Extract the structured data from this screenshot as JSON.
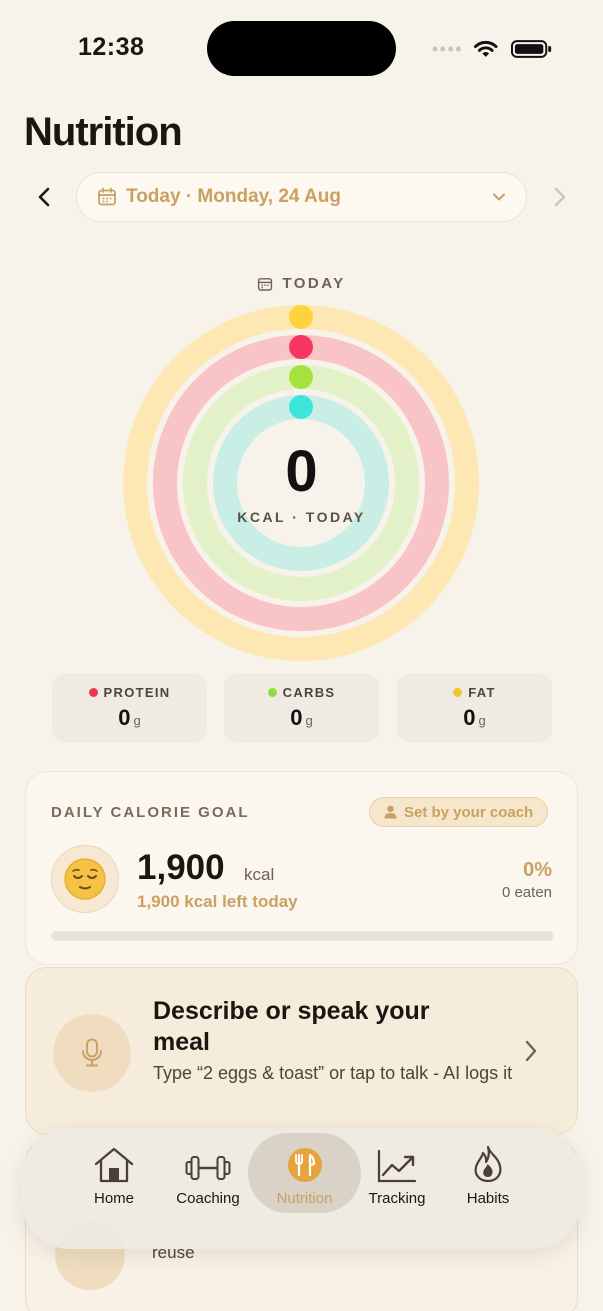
{
  "status_bar": {
    "time": "12:38"
  },
  "header": {
    "title": "Nutrition"
  },
  "date_nav": {
    "label": "Today · Monday, 24 Aug"
  },
  "rings": {
    "heading": "TODAY",
    "calories_value": "0",
    "calories_label": "KCAL · TODAY",
    "ring_colors": [
      "#fde8b4",
      "#f8c4c6",
      "#e2f1c7",
      "#c8eee6"
    ],
    "dot_colors": [
      "#fed33b",
      "#f73663",
      "#a6e23f",
      "#3ee5dc"
    ],
    "progress": [
      0,
      0,
      0,
      0
    ]
  },
  "macros": [
    {
      "name": "PROTEIN",
      "value": "0",
      "unit": "g",
      "color": "#f0344f"
    },
    {
      "name": "CARBS",
      "value": "0",
      "unit": "g",
      "color": "#8edc3d"
    },
    {
      "name": "FAT",
      "value": "0",
      "unit": "g",
      "color": "#f3c432"
    }
  ],
  "goal": {
    "title": "DAILY CALORIE GOAL",
    "badge": "Set by your coach",
    "value": "1,900",
    "unit": "kcal",
    "left_text": "1,900 kcal left today",
    "percent": "0%",
    "eaten": "0 eaten",
    "progress_fraction": 0
  },
  "meal_entry": {
    "title": "Describe or speak your meal",
    "subtitle": "Type “2 eggs & toast” or tap to talk - AI logs it"
  },
  "peek_card": {
    "text": "reuse"
  },
  "tabs": [
    {
      "label": "Home",
      "icon": "home-icon"
    },
    {
      "label": "Coaching",
      "icon": "dumbbell-icon"
    },
    {
      "label": "Nutrition",
      "icon": "fork-knife-icon",
      "active": true
    },
    {
      "label": "Tracking",
      "icon": "chart-line-icon"
    },
    {
      "label": "Habits",
      "icon": "flame-icon"
    }
  ],
  "colors": {
    "accent": "#caa063",
    "background": "#f7f2ea"
  }
}
